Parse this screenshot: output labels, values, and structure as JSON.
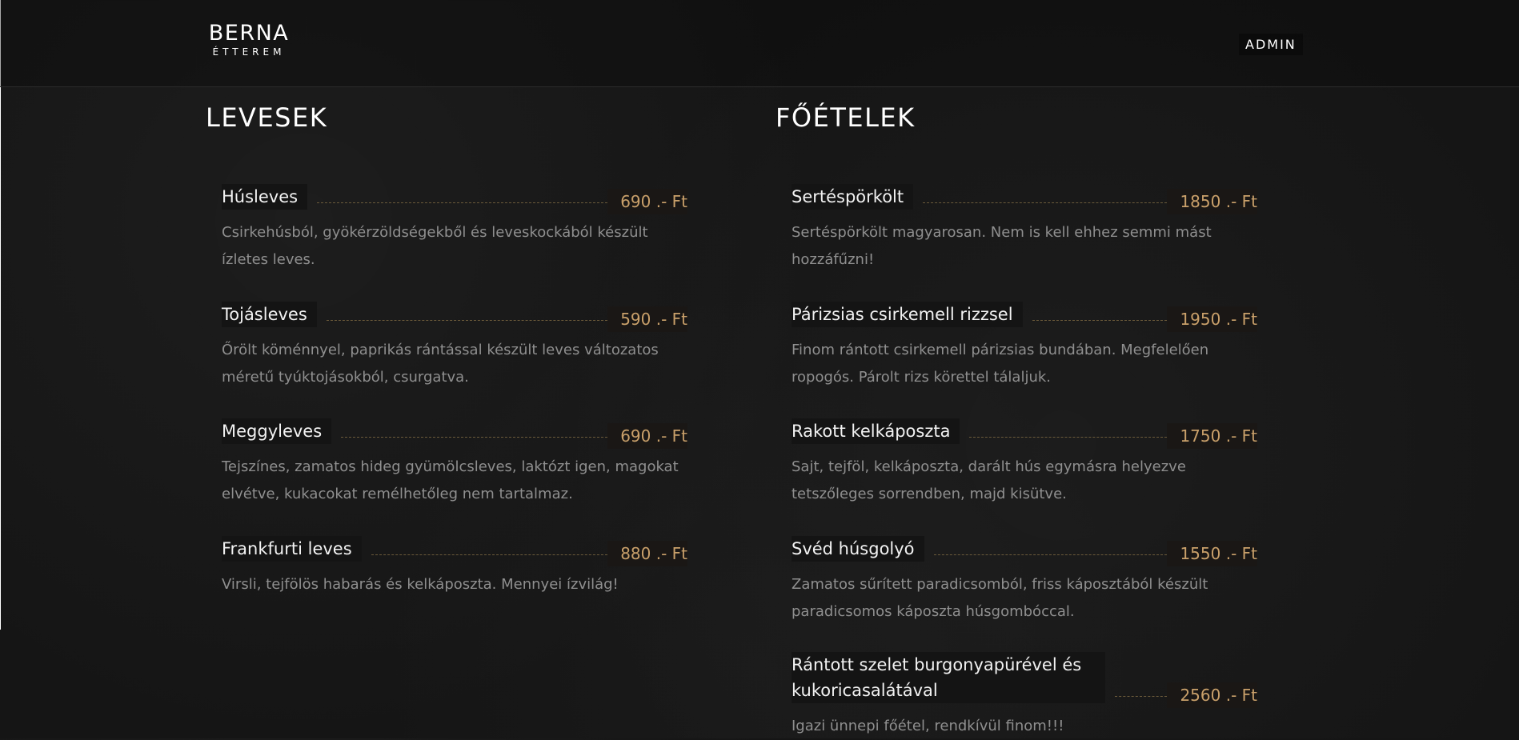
{
  "header": {
    "logo_main": "BERNA",
    "logo_sub": "ÉTTEREM",
    "admin_label": "ADMIN"
  },
  "sections": [
    {
      "title": "LEVESEK",
      "items": [
        {
          "name": "Húsleves",
          "price": "690 .- Ft",
          "description": "Csirkehúsból, gyökérzöldségekből és leveskockából készült ízletes leves."
        },
        {
          "name": "Tojásleves",
          "price": "590 .- Ft",
          "description": "Őrölt köménnyel, paprikás rántással készült leves változatos méretű tyúktojásokból, csurgatva."
        },
        {
          "name": "Meggyleves",
          "price": "690 .- Ft",
          "description": "Tejszínes, zamatos hideg gyümölcsleves, laktózt igen, magokat elvétve, kukacokat remélhetőleg nem tartalmaz."
        },
        {
          "name": "Frankfurti leves",
          "price": "880 .- Ft",
          "description": "Virsli, tejfölös habarás és kelkáposzta. Mennyei ízvilág!"
        }
      ]
    },
    {
      "title": "FŐÉTELEK",
      "items": [
        {
          "name": "Sertéspörkölt",
          "price": "1850 .- Ft",
          "description": "Sertéspörkölt magyarosan. Nem is kell ehhez semmi mást hozzáfűzni!"
        },
        {
          "name": "Párizsias csirkemell rizzsel",
          "price": "1950 .- Ft",
          "description": "Finom rántott csirkemell párizsias bundában. Megfelelően ropogós. Párolt rizs körettel tálaljuk."
        },
        {
          "name": "Rakott kelkáposzta",
          "price": "1750 .- Ft",
          "description": "Sajt, tejföl, kelkáposzta, darált hús egymásra helyezve tetszőleges sorrendben, majd kisütve."
        },
        {
          "name": "Svéd húsgolyó",
          "price": "1550 .- Ft",
          "description": "Zamatos sűrített paradicsomból, friss káposztából készült paradicsomos káposzta húsgombóccal."
        },
        {
          "name": "Rántott szelet burgonyapürével és kukoricasalátával",
          "price": "2560 .- Ft",
          "description": "Igazi ünnepi főétel, rendkívül finom!!!"
        }
      ]
    }
  ]
}
